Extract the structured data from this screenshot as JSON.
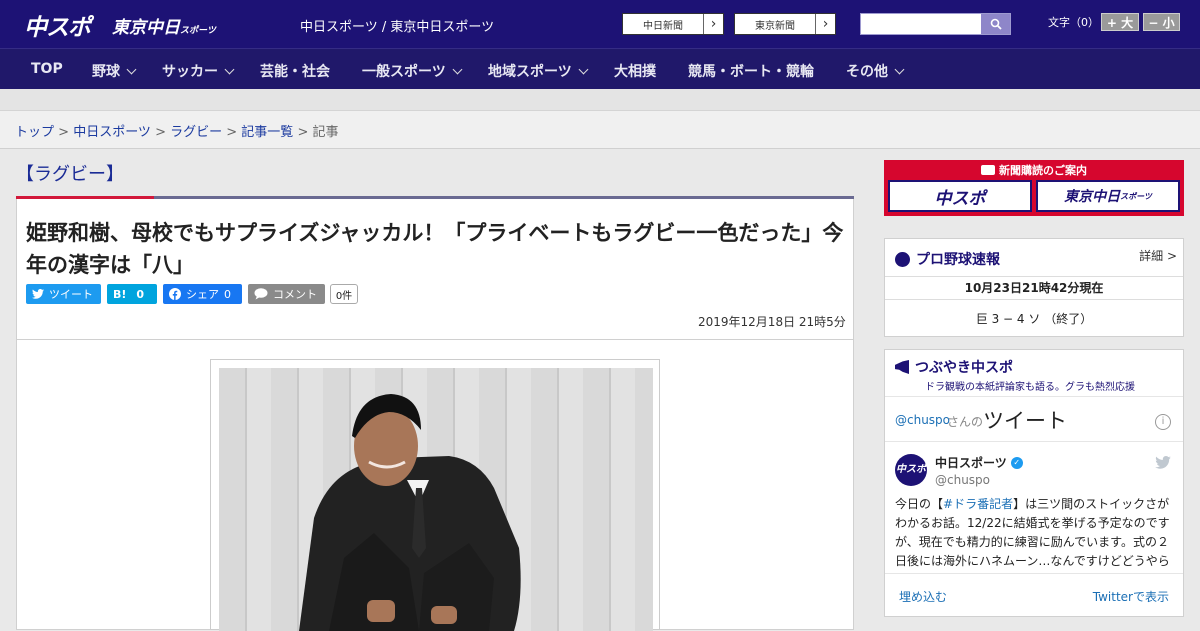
{
  "header": {
    "logo_main": "中スポ",
    "logo_tokyo": "東京中日",
    "logo_tokyo_small": "スポーツ",
    "site_links": "中日スポーツ / 東京中日スポーツ",
    "btn_chunichi": "中日新聞",
    "btn_tokyo": "東京新聞",
    "font_label": "文字（0）",
    "font_bigger": "+ 大",
    "font_smaller": "− 小"
  },
  "nav": {
    "items": [
      "TOP",
      "野球",
      "サッカー",
      "芸能・社会",
      "一般スポーツ",
      "地域スポーツ",
      "大相撲",
      "競馬・ボート・競輪",
      "その他"
    ]
  },
  "breadcrumb": {
    "items": [
      "トップ",
      "中日スポーツ",
      "ラグビー",
      "記事一覧"
    ],
    "current": "記事"
  },
  "article": {
    "category": "【ラグビー】",
    "title": "姫野和樹、母校でもサプライズジャッカル！「プライベートもラグビー一色だった」今年の漢字は「八」",
    "share": {
      "tweet": "ツイート",
      "hatena": "B!",
      "hatena_count": "0",
      "facebook": "シェア",
      "facebook_count": "0",
      "comment": "コメント",
      "comment_count": "0件"
    },
    "date": "2019年12月18日 21時5分"
  },
  "sidebar": {
    "subscribe": {
      "title": "新聞購読のご案内",
      "left": "中スポ",
      "right": "東京中日",
      "right_small": "スポーツ"
    },
    "baseball": {
      "title": "プロ野球速報",
      "detail": "詳細 >",
      "time": "10月23日21時42分現在",
      "score": "巨 3 − 4 ソ （終了）"
    },
    "tweets": {
      "title": "つぶやき中スポ",
      "subtitle": "ドラ観戦の本紙評論家も語る。グラも熱烈応援",
      "handle": "@chuspo",
      "handle_suffix": "さんの",
      "heading": "ツイート",
      "account_name": "中日スポーツ",
      "account_handle": "@chuspo",
      "avatar_text": "中スポ",
      "tweet_pre": "今日の【",
      "tweet_hashtag": "#ドラ番記者",
      "tweet_post": "】は三ツ間のストイックさがわかるお話。12/22に結婚式を挙げる予定なのですが、現在でも精力的に練習に励んでいます。式の２日後には海外にハネムーン…なんですけどどうやら",
      "embed": "埋め込む",
      "view": "Twitterで表示"
    }
  },
  "colors": {
    "header_bg": "#1d1275",
    "nav_bg": "#20186a",
    "accent_red": "#d2183a",
    "link": "#1b3a9f",
    "twitter": "#1d9bf0",
    "hatena": "#00a4de",
    "facebook": "#1877f2",
    "comment": "#8a8a8a"
  }
}
